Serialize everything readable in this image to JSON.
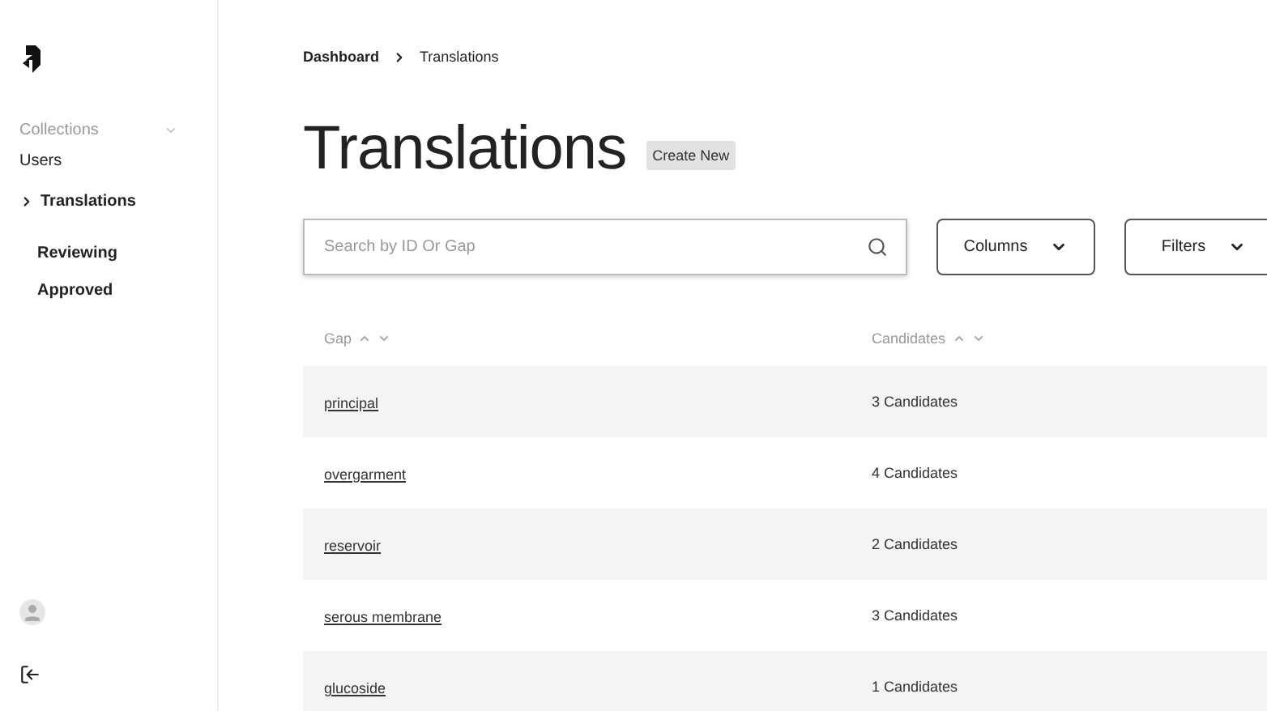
{
  "sidebar": {
    "section": "Collections",
    "items": [
      {
        "label": "Users",
        "selected": false
      },
      {
        "label": "Translations",
        "selected": true,
        "children": [
          {
            "label": "Reviewing"
          },
          {
            "label": "Approved"
          }
        ]
      }
    ]
  },
  "breadcrumb": [
    "Dashboard",
    "Translations"
  ],
  "page": {
    "title": "Translations",
    "action": "Create New"
  },
  "search": {
    "placeholder": "Search by ID Or Gap"
  },
  "toolbar": [
    "Columns",
    "Filters"
  ],
  "table": {
    "columns": [
      "Gap",
      "Candidates"
    ],
    "rows": [
      {
        "gap": "principal",
        "candidates": "3 Candidates"
      },
      {
        "gap": "overgarment",
        "candidates": "4 Candidates"
      },
      {
        "gap": "reservoir",
        "candidates": "2 Candidates"
      },
      {
        "gap": "serous membrane",
        "candidates": "3 Candidates"
      },
      {
        "gap": "glucoside",
        "candidates": "1 Candidates"
      }
    ]
  }
}
